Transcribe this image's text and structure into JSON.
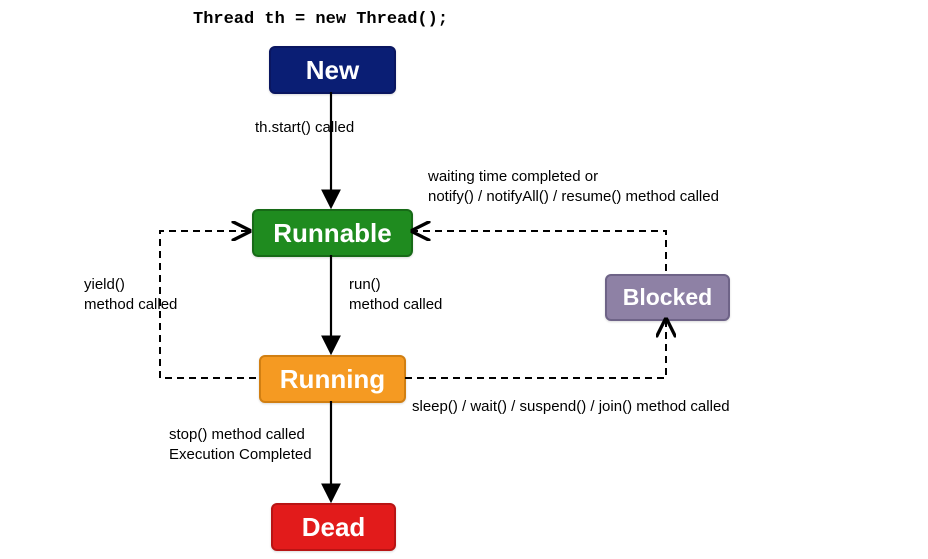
{
  "code_line": "Thread th = new Thread();",
  "states": {
    "new": "New",
    "runnable": "Runnable",
    "running": "Running",
    "blocked": "Blocked",
    "dead": "Dead"
  },
  "labels": {
    "start_called": "th.start() called",
    "run_called": "run()\nmethod called",
    "yield_called": "yield()\nmethod called",
    "to_blocked": "sleep() / wait() / suspend() / join() method called",
    "from_blocked": "waiting time completed or\nnotify() / notifyAll() / resume() method called",
    "to_dead": "stop() method called\nExecution Completed"
  }
}
